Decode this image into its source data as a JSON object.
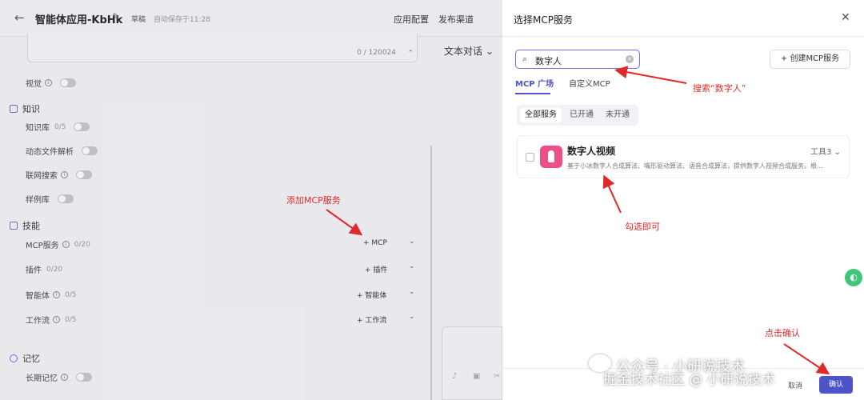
{
  "editor": {
    "title": "智能体应用-KbHk",
    "status": "草稿",
    "saved": "自动保存于11:28",
    "nav": [
      "应用配置",
      "发布渠道"
    ],
    "textarea_count": "0 / 120024",
    "dialog_mode": "文本对话",
    "vision_label": "视觉",
    "knowledge_section": "知识",
    "knowledge_rows": [
      {
        "label": "知识库",
        "count": "0/5"
      },
      {
        "label": "动态文件解析",
        "count": ""
      },
      {
        "label": "联网搜索",
        "count": ""
      },
      {
        "label": "样例库",
        "count": ""
      }
    ],
    "skills_section": "技能",
    "skill_rows": [
      {
        "label": "MCP服务",
        "count": "0/20",
        "add": "+ MCP"
      },
      {
        "label": "插件",
        "count": "0/20",
        "add": "+ 插件"
      },
      {
        "label": "智能体",
        "count": "0/5",
        "add": "+ 智能体"
      },
      {
        "label": "工作流",
        "count": "0/5",
        "add": "+ 工作流"
      }
    ],
    "memory_section": "记忆",
    "memory_row": "长期记忆"
  },
  "modal": {
    "title": "选择MCP服务",
    "search_value": "数字人",
    "create_label": "+ 创建MCP服务",
    "tabs": [
      "MCP 广场",
      "自定义MCP"
    ],
    "filters": [
      "全部服务",
      "已开通",
      "未开通"
    ],
    "card": {
      "name": "数字人视频",
      "tools": "工具3",
      "desc": "基于小冰数字人合成算法、嘴形驱动算法、语音合成算法，提供数字人视频合成服务。根..."
    },
    "cancel_label": "取消",
    "confirm_label": "确认"
  },
  "annotations": {
    "add_mcp": "添加MCP服务",
    "search": "搜索“数字人”",
    "check": "勾选即可",
    "confirm": "点击确认",
    "color": "#e02a2a"
  },
  "watermark": {
    "line1": "公众号 · 小研说技术",
    "line2": "掘金技术社区 @ 小研说技术"
  },
  "colors": {
    "accent": "#4e54c8",
    "brand_logo": "#ec4f8a"
  }
}
